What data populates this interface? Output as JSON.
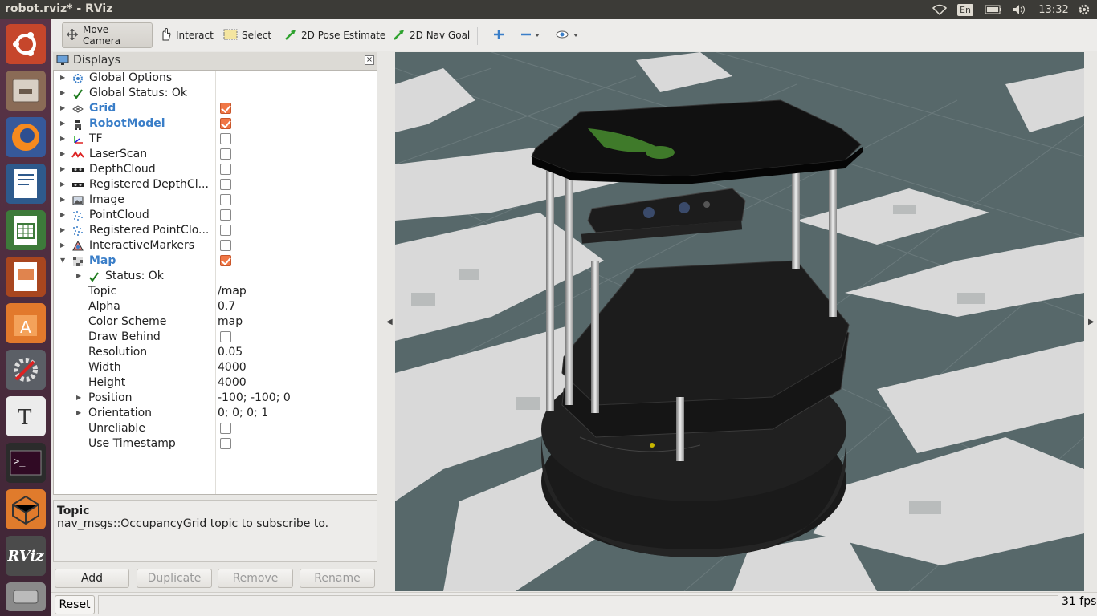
{
  "window": {
    "title": "robot.rviz* - RViz"
  },
  "tray": {
    "lang": "En",
    "clock": "13:32"
  },
  "launcher": {
    "items": [
      "ubuntu-icon",
      "files-icon",
      "firefox-icon",
      "writer-icon",
      "calc-icon",
      "impress-icon",
      "software-center-icon",
      "system-settings-icon",
      "text-editor-icon",
      "terminal-icon",
      "ubuntu-sdk-icon",
      "rviz-icon",
      "disk-icon"
    ],
    "rviz_label": "RViz"
  },
  "toolbar": {
    "move_camera": "Move Camera",
    "interact": "Interact",
    "select": "Select",
    "pose_estimate": "2D Pose Estimate",
    "nav_goal": "2D Nav Goal"
  },
  "displays": {
    "title": "Displays",
    "rows": [
      {
        "label": "Global Options",
        "icon": "gear-icon"
      },
      {
        "label": "Global Status: Ok",
        "icon": "check-icon"
      },
      {
        "label": "Grid",
        "icon": "grid-icon",
        "checked": true,
        "highlight": true
      },
      {
        "label": "RobotModel",
        "icon": "robot-icon",
        "checked": true,
        "highlight": true
      },
      {
        "label": "TF",
        "icon": "tf-icon",
        "checked": false
      },
      {
        "label": "LaserScan",
        "icon": "laserscan-icon",
        "checked": false
      },
      {
        "label": "DepthCloud",
        "icon": "depthcloud-icon",
        "checked": false
      },
      {
        "label": "Registered DepthCl...",
        "icon": "depthcloud-icon",
        "checked": false
      },
      {
        "label": "Image",
        "icon": "image-icon",
        "checked": false
      },
      {
        "label": "PointCloud",
        "icon": "pointcloud-icon",
        "checked": false
      },
      {
        "label": "Registered PointClo...",
        "icon": "pointcloud-icon",
        "checked": false
      },
      {
        "label": "InteractiveMarkers",
        "icon": "markers-icon",
        "checked": false
      },
      {
        "label": "Map",
        "icon": "map-icon",
        "checked": true,
        "highlight": true
      }
    ],
    "map_props": {
      "status": "Status: Ok",
      "topic_label": "Topic",
      "topic": "/map",
      "alpha_label": "Alpha",
      "alpha": "0.7",
      "scheme_label": "Color Scheme",
      "scheme": "map",
      "draw_behind_label": "Draw Behind",
      "resolution_label": "Resolution",
      "resolution": "0.05",
      "width_label": "Width",
      "width": "4000",
      "height_label": "Height",
      "height": "4000",
      "position_label": "Position",
      "position": "-100; -100; 0",
      "orientation_label": "Orientation",
      "orientation": "0; 0; 0; 1",
      "unreliable_label": "Unreliable",
      "timestamp_label": "Use Timestamp"
    }
  },
  "description": {
    "heading": "Topic",
    "text": "nav_msgs::OccupancyGrid topic to subscribe to."
  },
  "buttons": {
    "add": "Add",
    "duplicate": "Duplicate",
    "remove": "Remove",
    "rename": "Rename"
  },
  "status": {
    "reset": "Reset",
    "fps": "31 fps"
  },
  "colors": {
    "accent": "#f07746",
    "highlight": "#3a7ec8",
    "viewport_bg": "#57686a",
    "map_free": "#d9d9d9"
  }
}
